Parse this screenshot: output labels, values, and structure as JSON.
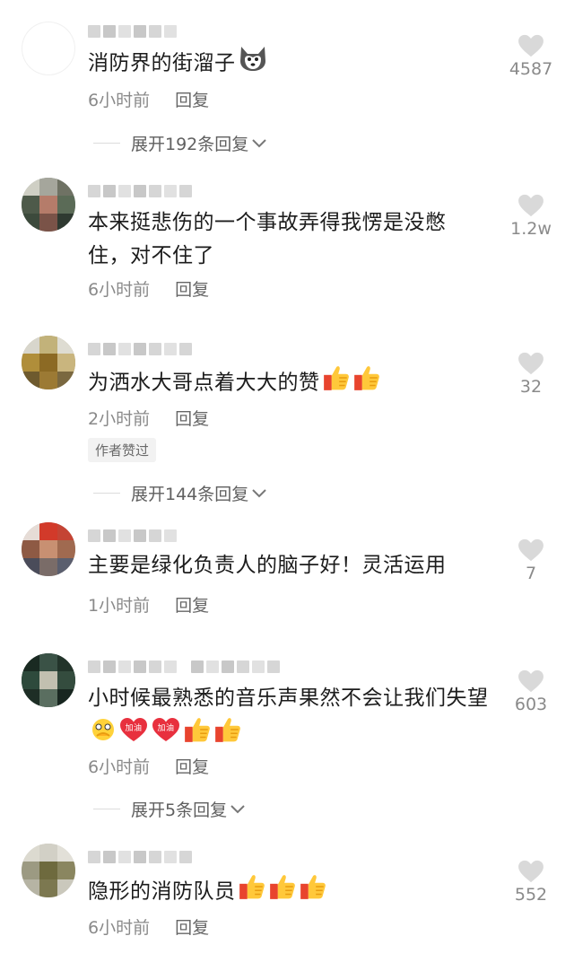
{
  "comments": [
    {
      "text": "消防界的街溜子",
      "time": "6小时前",
      "reply": "回复",
      "likes": "4587",
      "expand": "展开192条回复"
    },
    {
      "text": "本来挺悲伤的一个事故弄得我愣是没憋住，对不住了",
      "time": "6小时前",
      "reply": "回复",
      "likes": "1.2w"
    },
    {
      "text": "为洒水大哥点着大大的赞",
      "time": "2小时前",
      "reply": "回复",
      "likes": "32",
      "badge": "作者赞过",
      "expand": "展开144条回复"
    },
    {
      "text": "主要是绿化负责人的脑子好！灵活运用",
      "time": "1小时前",
      "reply": "回复",
      "likes": "7"
    },
    {
      "text": "小时候最熟悉的音乐声果然不会让我们失望",
      "time": "6小时前",
      "reply": "回复",
      "likes": "603",
      "expand": "展开5条回复"
    },
    {
      "text": "隐形的消防队员",
      "time": "6小时前",
      "reply": "回复",
      "likes": "552"
    }
  ],
  "icons": {
    "like": "heart-icon",
    "thumbs": "thumbs-up-emoji",
    "cheer": "jiayou-emoji",
    "dog": "husky-emoji",
    "chevron": "chevron-down-icon"
  },
  "emoji_text": {
    "jiayou": "加油"
  }
}
